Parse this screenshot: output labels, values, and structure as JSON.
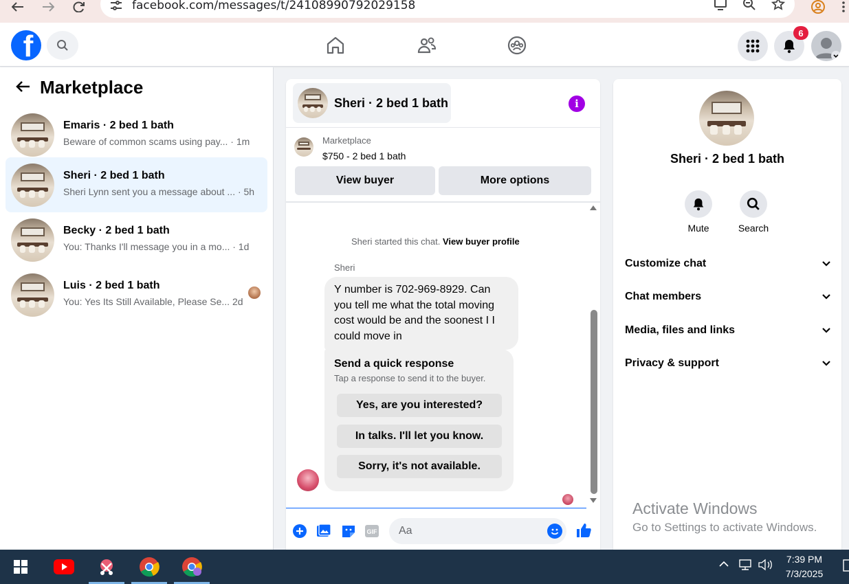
{
  "browser": {
    "url": "facebook.com/messages/t/24108990792029158"
  },
  "header": {
    "notification_count": "6"
  },
  "sidebar": {
    "title": "Marketplace",
    "conversations": [
      {
        "name": "Emaris · 2 bed 1 bath",
        "preview": "Beware of common scams using pay... · 1m",
        "active": false
      },
      {
        "name": "Sheri · 2 bed 1 bath",
        "preview": "Sheri Lynn sent you a message about ... · 5h",
        "active": true
      },
      {
        "name": "Becky · 2 bed 1 bath",
        "preview": "You: Thanks I'll message you in a mo... · 1d",
        "active": false
      },
      {
        "name": "Luis · 2 bed 1 bath",
        "preview": "You: Yes Its Still Available, Please Se... 2d",
        "active": false
      }
    ]
  },
  "chat": {
    "title": "Sheri · 2 bed 1 bath",
    "listing_label": "Marketplace",
    "listing_price": "$750 - 2 bed 1 bath",
    "view_buyer_label": "View buyer",
    "more_options_label": "More options",
    "system_message": "Sheri started this chat.",
    "system_link": "View buyer profile",
    "sender_name": "Sheri",
    "message": "Y number is 702-969-8929. Can you tell me what the total moving cost would be and the soonest I I could move in",
    "quick_title": "Send a quick response",
    "quick_subtitle": "Tap a response to send it to the buyer.",
    "quick_replies": [
      "Yes, are you interested?",
      "In talks. I'll let you know.",
      "Sorry, it's not available."
    ],
    "input_placeholder": "Aa",
    "gif_label": "GIF"
  },
  "details": {
    "name": "Sheri · 2 bed 1 bath",
    "mute_label": "Mute",
    "search_label": "Search",
    "sections": [
      "Customize chat",
      "Chat members",
      "Media, files and links",
      "Privacy & support"
    ]
  },
  "watermark": {
    "line1": "Activate Windows",
    "line2": "Go to Settings to activate Windows."
  },
  "taskbar": {
    "time": "7:39 PM",
    "date": "7/3/2025"
  },
  "colors": {
    "facebook_blue": "#0866ff",
    "info_purple": "#a100e4",
    "badge_red": "#e41e3f",
    "taskbar": "#1e3348"
  }
}
